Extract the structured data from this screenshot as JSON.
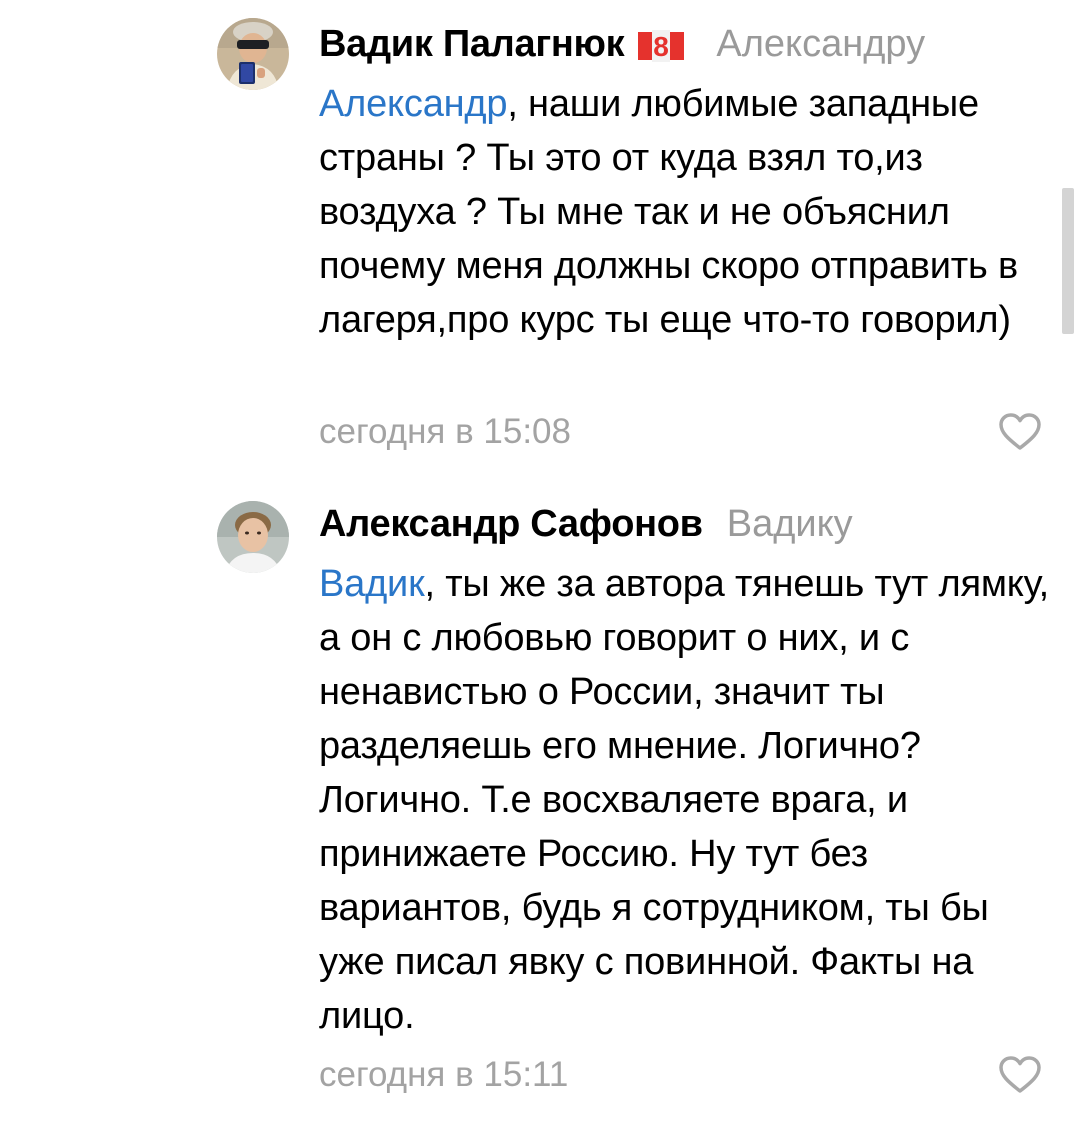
{
  "comments": [
    {
      "author": "Вадик Палагнюк",
      "reply_to": "Александру",
      "mention": "Александр",
      "text": ", наши любимые западные страны ? Ты это от куда взял то,из воздуха ? Ты мне так и не объяснил почему меня должны скоро отправить в лагеря,про курс ты еще что-то говорил)",
      "timestamp": "сегодня в 15:08",
      "avatar_icon": "user-avatar-photo",
      "badge_icon": "number-8-badge-icon",
      "badge_text": "8",
      "like_icon": "heart-outline-icon"
    },
    {
      "author": "Александр Сафонов",
      "reply_to": "Вадику",
      "mention": "Вадик",
      "text": ", ты же за автора тянешь тут лямку, а он с любовью говорит о них, и с ненавистью о России, значит ты разделяешь его мнение. Логично? Логично. Т.е восхваляете врага, и принижаете Россию. Ну тут без вариантов, будь я сотрудником, ты бы уже писал явку с повинной. Факты на лицо.",
      "timestamp": "сегодня в 15:11",
      "avatar_icon": "user-avatar-photo",
      "like_icon": "heart-outline-icon"
    }
  ],
  "colors": {
    "mention": "#2a76c8",
    "secondary_text": "#9a9a9a",
    "badge_red": "#e5322d",
    "scrollbar": "#d4d4d4"
  }
}
